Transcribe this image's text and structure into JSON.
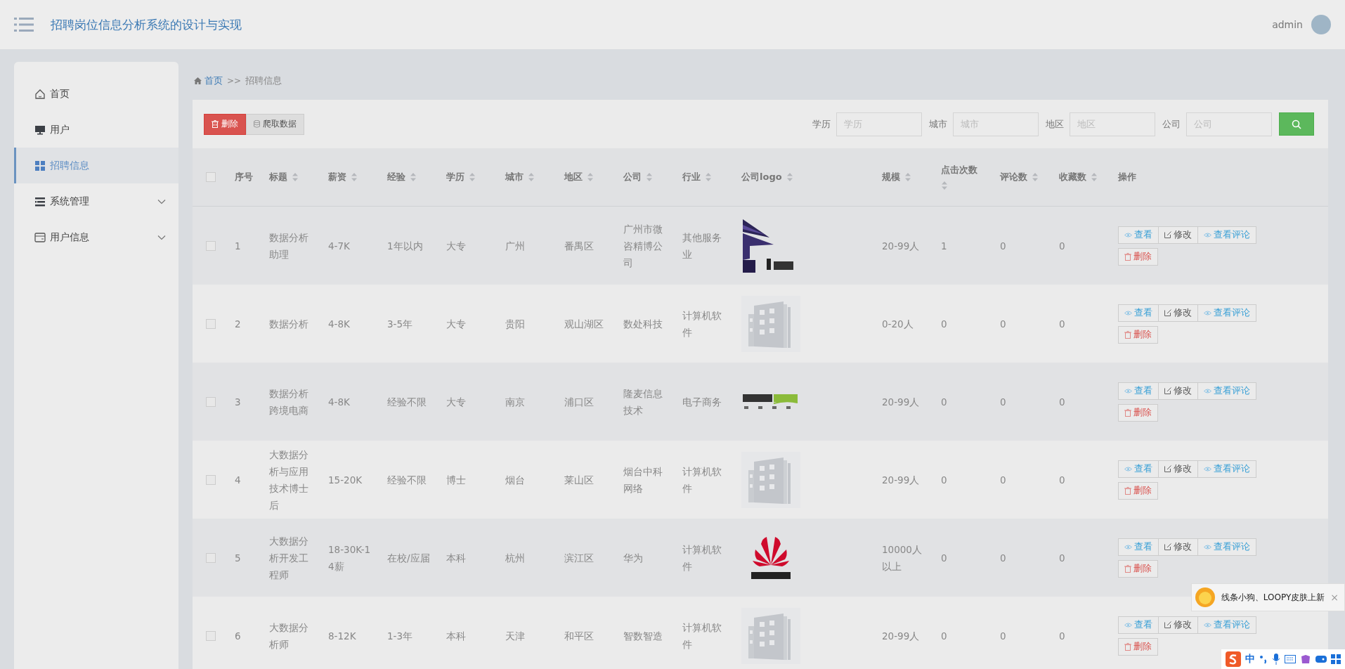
{
  "header": {
    "title": "招聘岗位信息分析系统的设计与实现",
    "user": "admin"
  },
  "sidebar": {
    "items": [
      {
        "label": "首页",
        "kind": "home",
        "selected": false,
        "expandable": false
      },
      {
        "label": "用户",
        "kind": "monitor",
        "selected": false,
        "expandable": false
      },
      {
        "label": "招聘信息",
        "kind": "grid",
        "selected": true,
        "expandable": false
      },
      {
        "label": "系统管理",
        "kind": "list",
        "selected": false,
        "expandable": true
      },
      {
        "label": "用户信息",
        "kind": "card",
        "selected": false,
        "expandable": true
      }
    ]
  },
  "breadcrumb": [
    {
      "label": "首页",
      "kind": "link"
    },
    {
      "label": ">>",
      "kind": "separator"
    },
    {
      "label": "招聘信息",
      "kind": "current"
    }
  ],
  "toolbar": {
    "buttons": [
      {
        "label": "删除",
        "kind": "danger"
      },
      {
        "label": "爬取数据",
        "kind": "default"
      }
    ],
    "filters": [
      {
        "label": "学历",
        "placeholder": "学历"
      },
      {
        "label": "城市",
        "placeholder": "城市"
      },
      {
        "label": "地区",
        "placeholder": "地区"
      },
      {
        "label": "公司",
        "placeholder": "公司"
      }
    ]
  },
  "table": {
    "select_all": {
      "checked": false
    },
    "columns": [
      {
        "label": "序号",
        "sortable": false
      },
      {
        "label": "标题",
        "sortable": true
      },
      {
        "label": "薪资",
        "sortable": true
      },
      {
        "label": "经验",
        "sortable": true
      },
      {
        "label": "学历",
        "sortable": true
      },
      {
        "label": "城市",
        "sortable": true
      },
      {
        "label": "地区",
        "sortable": true
      },
      {
        "label": "公司",
        "sortable": true
      },
      {
        "label": "行业",
        "sortable": true
      },
      {
        "label": "公司logo",
        "sortable": true
      },
      {
        "label": "规模",
        "sortable": true
      },
      {
        "label": "点击次数",
        "sortable": true
      },
      {
        "label": "评论数",
        "sortable": true
      },
      {
        "label": "收藏数",
        "sortable": true
      },
      {
        "label": "操作",
        "sortable": false
      }
    ],
    "rows": [
      {
        "checked": false,
        "cells": [
          "1",
          "数据分析助理",
          "4-7K",
          "1年以内",
          "大专",
          "广州",
          "番禺区",
          "广州市微咨精博公司",
          "其他服务业"
        ],
        "logo": {
          "kind": "picture"
        },
        "metrics": [
          "20-99人",
          "1",
          "0",
          "0"
        ],
        "actions": [
          {
            "label": "查看",
            "kind": "view"
          },
          {
            "label": "修改",
            "kind": "edit"
          },
          {
            "label": "查看评论",
            "kind": "view"
          },
          {
            "label": "删除",
            "kind": "delete"
          }
        ]
      },
      {
        "checked": false,
        "cells": [
          "2",
          "数据分析",
          "4-8K",
          "3-5年",
          "大专",
          "贵阳",
          "观山湖区",
          "数处科技",
          "计算机软件"
        ],
        "logo": {
          "kind": "placeholder"
        },
        "metrics": [
          "0-20人",
          "0",
          "0",
          "0"
        ],
        "actions": [
          {
            "label": "查看",
            "kind": "view"
          },
          {
            "label": "修改",
            "kind": "edit"
          },
          {
            "label": "查看评论",
            "kind": "view"
          },
          {
            "label": "删除",
            "kind": "delete"
          }
        ]
      },
      {
        "checked": false,
        "cells": [
          "3",
          "数据分析跨境电商",
          "4-8K",
          "经验不限",
          "大专",
          "南京",
          "浦口区",
          "隆麦信息技术",
          "电子商务"
        ],
        "logo": {
          "kind": "picture"
        },
        "metrics": [
          "20-99人",
          "0",
          "0",
          "0"
        ],
        "actions": [
          {
            "label": "查看",
            "kind": "view"
          },
          {
            "label": "修改",
            "kind": "edit"
          },
          {
            "label": "查看评论",
            "kind": "view"
          },
          {
            "label": "删除",
            "kind": "delete"
          }
        ]
      },
      {
        "checked": false,
        "cells": [
          "4",
          "大数据分析与应用技术博士后",
          "15-20K",
          "经验不限",
          "博士",
          "烟台",
          "莱山区",
          "烟台中科网络",
          "计算机软件"
        ],
        "logo": {
          "kind": "placeholder"
        },
        "metrics": [
          "20-99人",
          "0",
          "0",
          "0"
        ],
        "actions": [
          {
            "label": "查看",
            "kind": "view"
          },
          {
            "label": "修改",
            "kind": "edit"
          },
          {
            "label": "查看评论",
            "kind": "view"
          },
          {
            "label": "删除",
            "kind": "delete"
          }
        ]
      },
      {
        "checked": false,
        "cells": [
          "5",
          "大数据分析开发工程师",
          "18-30K-14薪",
          "在校/应届",
          "本科",
          "杭州",
          "滨江区",
          "华为",
          "计算机软件"
        ],
        "logo": {
          "kind": "picture"
        },
        "metrics": [
          "10000人以上",
          "0",
          "0",
          "0"
        ],
        "actions": [
          {
            "label": "查看",
            "kind": "view"
          },
          {
            "label": "修改",
            "kind": "edit"
          },
          {
            "label": "查看评论",
            "kind": "view"
          },
          {
            "label": "删除",
            "kind": "delete"
          }
        ]
      },
      {
        "checked": false,
        "cells": [
          "6",
          "大数据分析师",
          "8-12K",
          "1-3年",
          "本科",
          "天津",
          "和平区",
          "智数智造",
          "计算机软件"
        ],
        "logo": {
          "kind": "placeholder"
        },
        "metrics": [
          "20-99人",
          "0",
          "0",
          "0"
        ],
        "actions": [
          {
            "label": "查看",
            "kind": "view"
          },
          {
            "label": "修改",
            "kind": "edit"
          },
          {
            "label": "查看评论",
            "kind": "view"
          },
          {
            "label": "删除",
            "kind": "delete"
          }
        ]
      }
    ]
  },
  "notification": {
    "text": "线条小狗、LOOPY皮肤上新",
    "close": "×"
  },
  "ime_bar": {
    "mode": "中"
  }
}
